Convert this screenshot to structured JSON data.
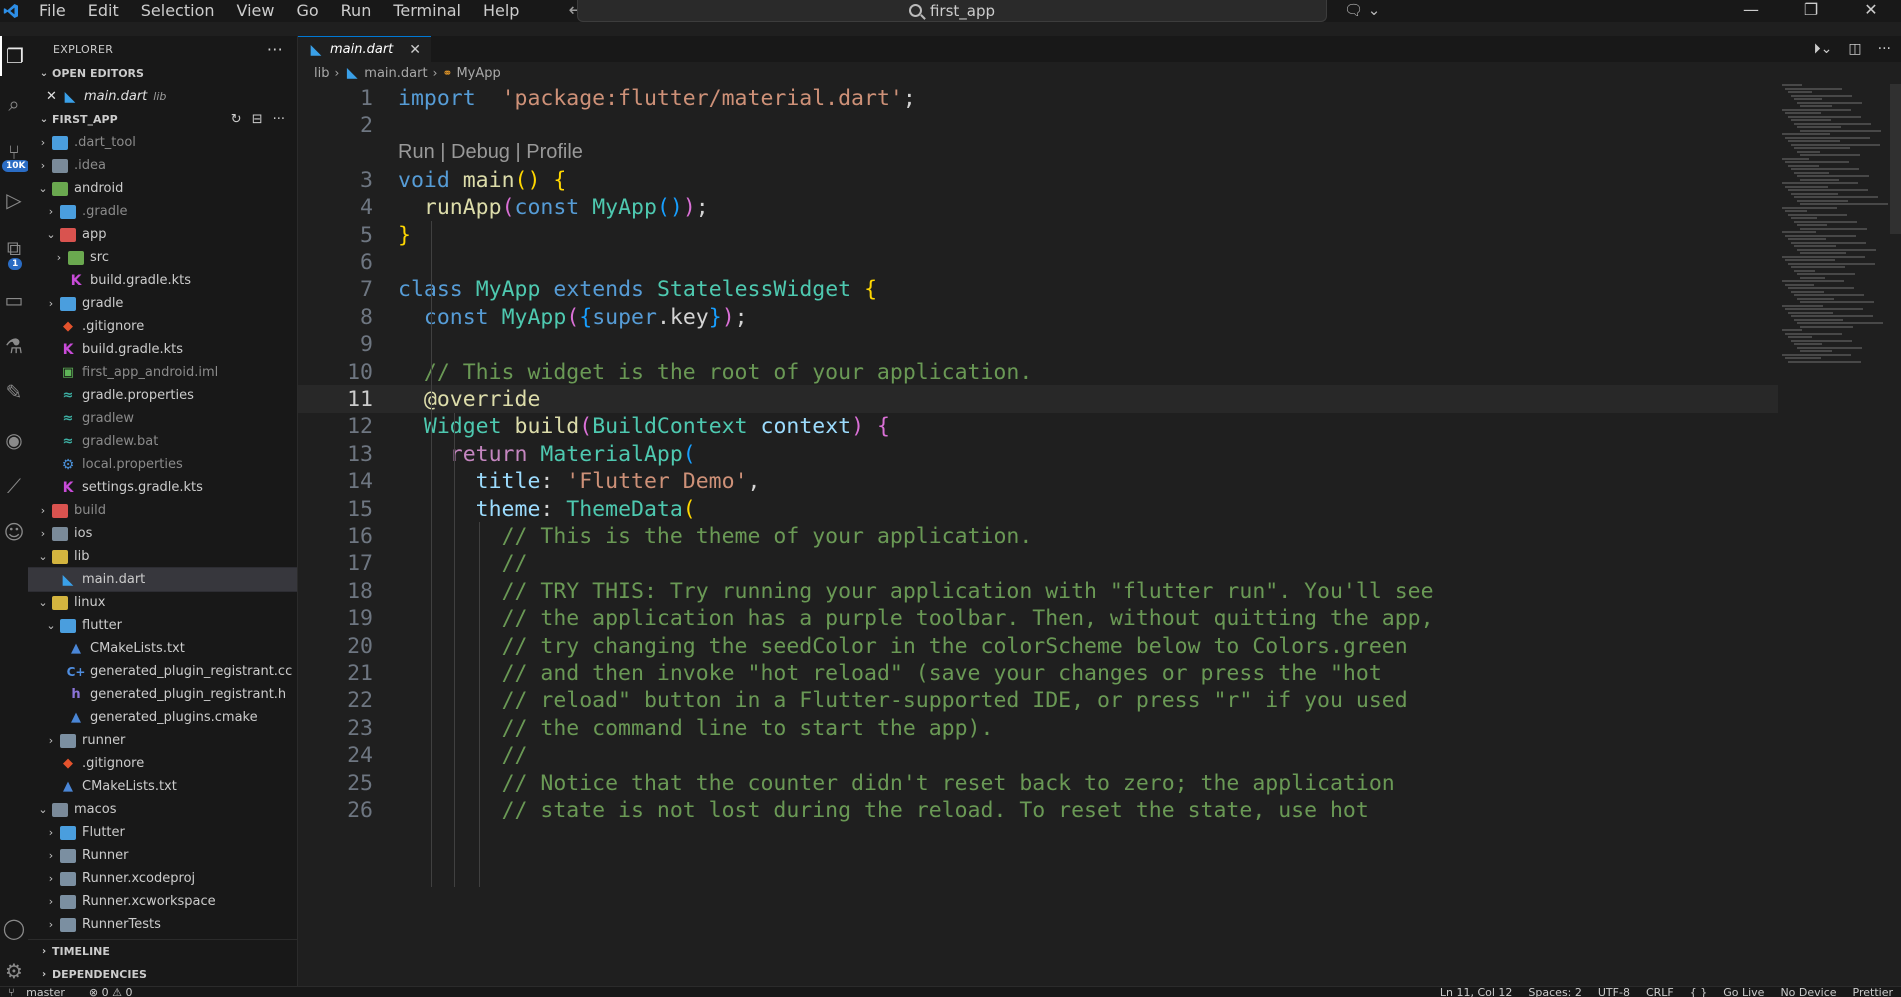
{
  "titlebar": {
    "menu": [
      "File",
      "Edit",
      "Selection",
      "View",
      "Go",
      "Run",
      "Terminal",
      "Help"
    ],
    "search_text": "first_app",
    "window_controls": [
      "—",
      "❐",
      "✕"
    ]
  },
  "activity_badges": {
    "source_control": "10K",
    "extensions": "1"
  },
  "sidebar": {
    "title": "EXPLORER",
    "more": "···",
    "open_editors_label": "OPEN EDITORS",
    "open_editor": {
      "name": "main.dart",
      "folder": "lib"
    },
    "project_label": "FIRST_APP",
    "tree": [
      {
        "label": ".dart_tool",
        "depth": 0,
        "chev": "›",
        "icon": "folder",
        "dim": true
      },
      {
        "label": ".idea",
        "depth": 0,
        "chev": "›",
        "icon": "folder-grey",
        "dim": true
      },
      {
        "label": "android",
        "depth": 0,
        "chev": "⌄",
        "icon": "folder-green"
      },
      {
        "label": ".gradle",
        "depth": 1,
        "chev": "›",
        "icon": "folder",
        "dim": true
      },
      {
        "label": "app",
        "depth": 1,
        "chev": "⌄",
        "icon": "folder-red"
      },
      {
        "label": "src",
        "depth": 2,
        "chev": "›",
        "icon": "folder-green"
      },
      {
        "label": "build.gradle.kts",
        "depth": 2,
        "chev": "",
        "icon": "kts"
      },
      {
        "label": "gradle",
        "depth": 1,
        "chev": "›",
        "icon": "folder"
      },
      {
        "label": ".gitignore",
        "depth": 1,
        "chev": "",
        "icon": "git"
      },
      {
        "label": "build.gradle.kts",
        "depth": 1,
        "chev": "",
        "icon": "kts"
      },
      {
        "label": "first_app_android.iml",
        "depth": 1,
        "chev": "",
        "icon": "green",
        "dim": true
      },
      {
        "label": "gradle.properties",
        "depth": 1,
        "chev": "",
        "icon": "gradlew"
      },
      {
        "label": "gradlew",
        "depth": 1,
        "chev": "",
        "icon": "gradlew",
        "dim": true
      },
      {
        "label": "gradlew.bat",
        "depth": 1,
        "chev": "",
        "icon": "gradlew",
        "dim": true
      },
      {
        "label": "local.properties",
        "depth": 1,
        "chev": "",
        "icon": "gear",
        "dim": true
      },
      {
        "label": "settings.gradle.kts",
        "depth": 1,
        "chev": "",
        "icon": "kts"
      },
      {
        "label": "build",
        "depth": 0,
        "chev": "›",
        "icon": "folder-red",
        "dim": true
      },
      {
        "label": "ios",
        "depth": 0,
        "chev": "›",
        "icon": "folder-grey"
      },
      {
        "label": "lib",
        "depth": 0,
        "chev": "⌄",
        "icon": "folder-yellow"
      },
      {
        "label": "main.dart",
        "depth": 1,
        "chev": "",
        "icon": "dart",
        "selected": true
      },
      {
        "label": "linux",
        "depth": 0,
        "chev": "⌄",
        "icon": "folder-yellow"
      },
      {
        "label": "flutter",
        "depth": 1,
        "chev": "⌄",
        "icon": "folder"
      },
      {
        "label": "CMakeLists.txt",
        "depth": 2,
        "chev": "",
        "icon": "cmake"
      },
      {
        "label": "generated_plugin_registrant.cc",
        "depth": 2,
        "chev": "",
        "icon": "cpp"
      },
      {
        "label": "generated_plugin_registrant.h",
        "depth": 2,
        "chev": "",
        "icon": "h"
      },
      {
        "label": "generated_plugins.cmake",
        "depth": 2,
        "chev": "",
        "icon": "cmake"
      },
      {
        "label": "runner",
        "depth": 1,
        "chev": "›",
        "icon": "folder-plain"
      },
      {
        "label": ".gitignore",
        "depth": 1,
        "chev": "",
        "icon": "git"
      },
      {
        "label": "CMakeLists.txt",
        "depth": 1,
        "chev": "",
        "icon": "cmake"
      },
      {
        "label": "macos",
        "depth": 0,
        "chev": "⌄",
        "icon": "folder-grey"
      },
      {
        "label": "Flutter",
        "depth": 1,
        "chev": "›",
        "icon": "folder"
      },
      {
        "label": "Runner",
        "depth": 1,
        "chev": "›",
        "icon": "folder-plain"
      },
      {
        "label": "Runner.xcodeproj",
        "depth": 1,
        "chev": "›",
        "icon": "folder-plain"
      },
      {
        "label": "Runner.xcworkspace",
        "depth": 1,
        "chev": "›",
        "icon": "folder-plain"
      },
      {
        "label": "RunnerTests",
        "depth": 1,
        "chev": "›",
        "icon": "folder-plain"
      }
    ],
    "timeline_label": "TIMELINE",
    "dependencies_label": "DEPENDENCIES"
  },
  "editor": {
    "tab_label": "main.dart",
    "breadcrumb": {
      "folder": "lib",
      "file": "main.dart",
      "symbol": "MyApp"
    },
    "codelens": "Run | Debug | Profile",
    "current_line": 11,
    "lines": [
      {
        "n": "1",
        "tokens": [
          [
            "kw",
            "import"
          ],
          [
            "",
            "  "
          ],
          [
            "str",
            "'package:flutter/material.dart'"
          ],
          [
            "",
            ";"
          ]
        ]
      },
      {
        "n": "2",
        "tokens": []
      },
      {
        "n": "3",
        "tokens": [
          [
            "kw",
            "void"
          ],
          [
            "",
            " "
          ],
          [
            "fn",
            "main"
          ],
          [
            "br1",
            "()"
          ],
          [
            "",
            " "
          ],
          [
            "br1",
            "{"
          ]
        ]
      },
      {
        "n": "4",
        "tokens": [
          [
            "",
            "  "
          ],
          [
            "fn",
            "runApp"
          ],
          [
            "br2",
            "("
          ],
          [
            "kw",
            "const"
          ],
          [
            "",
            " "
          ],
          [
            "cls",
            "MyApp"
          ],
          [
            "br3",
            "()"
          ],
          [
            "br2",
            ")"
          ],
          [
            "",
            ";"
          ]
        ]
      },
      {
        "n": "5",
        "tokens": [
          [
            "br1",
            "}"
          ]
        ]
      },
      {
        "n": "6",
        "tokens": []
      },
      {
        "n": "7",
        "tokens": [
          [
            "kw",
            "class"
          ],
          [
            "",
            " "
          ],
          [
            "cls",
            "MyApp"
          ],
          [
            "",
            " "
          ],
          [
            "kw",
            "extends"
          ],
          [
            "",
            " "
          ],
          [
            "cls",
            "StatelessWidget"
          ],
          [
            "",
            " "
          ],
          [
            "br1",
            "{"
          ]
        ]
      },
      {
        "n": "8",
        "tokens": [
          [
            "",
            "  "
          ],
          [
            "kw",
            "const"
          ],
          [
            "",
            " "
          ],
          [
            "cls",
            "MyApp"
          ],
          [
            "br2",
            "("
          ],
          [
            "br3",
            "{"
          ],
          [
            "kw",
            "super"
          ],
          [
            "",
            ".key"
          ],
          [
            "br3",
            "}"
          ],
          [
            "br2",
            ")"
          ],
          [
            "",
            ";"
          ]
        ]
      },
      {
        "n": "9",
        "tokens": []
      },
      {
        "n": "10",
        "tokens": [
          [
            "",
            "  "
          ],
          [
            "cmt",
            "// This widget is the root of your application."
          ]
        ]
      },
      {
        "n": "11",
        "tokens": [
          [
            "",
            "  "
          ],
          [
            "deco",
            "@override"
          ]
        ]
      },
      {
        "n": "12",
        "tokens": [
          [
            "",
            "  "
          ],
          [
            "cls",
            "Widget"
          ],
          [
            "",
            " "
          ],
          [
            "fn",
            "build"
          ],
          [
            "br2",
            "("
          ],
          [
            "cls",
            "BuildContext"
          ],
          [
            "",
            " "
          ],
          [
            "prm",
            "context"
          ],
          [
            "br2",
            ")"
          ],
          [
            "",
            " "
          ],
          [
            "br2",
            "{"
          ]
        ]
      },
      {
        "n": "13",
        "tokens": [
          [
            "",
            "    "
          ],
          [
            "kw2",
            "return"
          ],
          [
            "",
            " "
          ],
          [
            "cls",
            "MaterialApp"
          ],
          [
            "br3",
            "("
          ]
        ]
      },
      {
        "n": "14",
        "tokens": [
          [
            "",
            "      "
          ],
          [
            "prm",
            "title"
          ],
          [
            "",
            ": "
          ],
          [
            "str",
            "'Flutter Demo'"
          ],
          [
            "",
            ","
          ]
        ]
      },
      {
        "n": "15",
        "tokens": [
          [
            "",
            "      "
          ],
          [
            "prm",
            "theme"
          ],
          [
            "",
            ": "
          ],
          [
            "cls",
            "ThemeData"
          ],
          [
            "br1",
            "("
          ]
        ]
      },
      {
        "n": "16",
        "tokens": [
          [
            "",
            "        "
          ],
          [
            "cmt",
            "// This is the theme of your application."
          ]
        ]
      },
      {
        "n": "17",
        "tokens": [
          [
            "",
            "        "
          ],
          [
            "cmt",
            "//"
          ]
        ]
      },
      {
        "n": "18",
        "tokens": [
          [
            "",
            "        "
          ],
          [
            "cmt",
            "// TRY THIS: Try running your application with \"flutter run\". You'll see"
          ]
        ]
      },
      {
        "n": "19",
        "tokens": [
          [
            "",
            "        "
          ],
          [
            "cmt",
            "// the application has a purple toolbar. Then, without quitting the app,"
          ]
        ]
      },
      {
        "n": "20",
        "tokens": [
          [
            "",
            "        "
          ],
          [
            "cmt",
            "// try changing the seedColor in the colorScheme below to Colors.green"
          ]
        ]
      },
      {
        "n": "21",
        "tokens": [
          [
            "",
            "        "
          ],
          [
            "cmt",
            "// and then invoke \"hot reload\" (save your changes or press the \"hot"
          ]
        ]
      },
      {
        "n": "22",
        "tokens": [
          [
            "",
            "        "
          ],
          [
            "cmt",
            "// reload\" button in a Flutter-supported IDE, or press \"r\" if you used"
          ]
        ]
      },
      {
        "n": "23",
        "tokens": [
          [
            "",
            "        "
          ],
          [
            "cmt",
            "// the command line to start the app)."
          ]
        ]
      },
      {
        "n": "24",
        "tokens": [
          [
            "",
            "        "
          ],
          [
            "cmt",
            "//"
          ]
        ]
      },
      {
        "n": "25",
        "tokens": [
          [
            "",
            "        "
          ],
          [
            "cmt",
            "// Notice that the counter didn't reset back to zero; the application"
          ]
        ]
      },
      {
        "n": "26",
        "tokens": [
          [
            "",
            "        "
          ],
          [
            "cmt",
            "// state is not lost during the reload. To reset the state, use hot"
          ]
        ]
      }
    ]
  },
  "statusbar": {
    "branch": "master",
    "problems": "⊗ 0 ⚠ 0",
    "position": "Ln 11, Col 12",
    "spaces": "Spaces: 2",
    "encoding": "UTF-8",
    "eol": "CRLF",
    "language": "{ }",
    "golive": "Go Live",
    "device": "No Device",
    "prettier": "Prettier"
  },
  "colors": {
    "accent": "#0078d4",
    "editor_bg": "#1f1f1f",
    "sidebar_bg": "#181818"
  }
}
